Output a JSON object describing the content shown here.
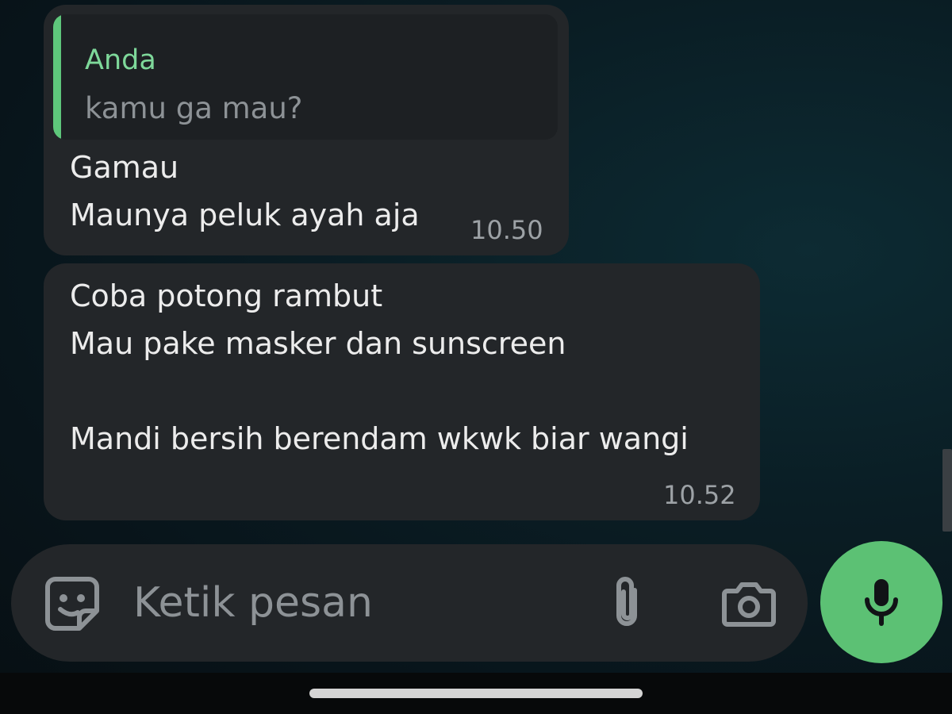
{
  "messages": [
    {
      "quote": {
        "author": "Anda",
        "text": "kamu ga mau?"
      },
      "lines": [
        "Gamau",
        "Maunya peluk ayah aja"
      ],
      "time": "10.50"
    },
    {
      "lines": [
        "Coba potong rambut",
        "Mau pake masker dan sunscreen",
        "",
        "Mandi bersih berendam wkwk biar wangi"
      ],
      "time": "10.52"
    }
  ],
  "composer": {
    "placeholder": "Ketik pesan",
    "icons": {
      "emoji": "sticker-icon",
      "attach": "paperclip-icon",
      "camera": "camera-icon",
      "mic": "mic-icon"
    }
  },
  "colors": {
    "bubble": "#232629",
    "quote_bar": "#5ec77b",
    "quote_author": "#7ed89a",
    "accent": "#5cc174"
  }
}
